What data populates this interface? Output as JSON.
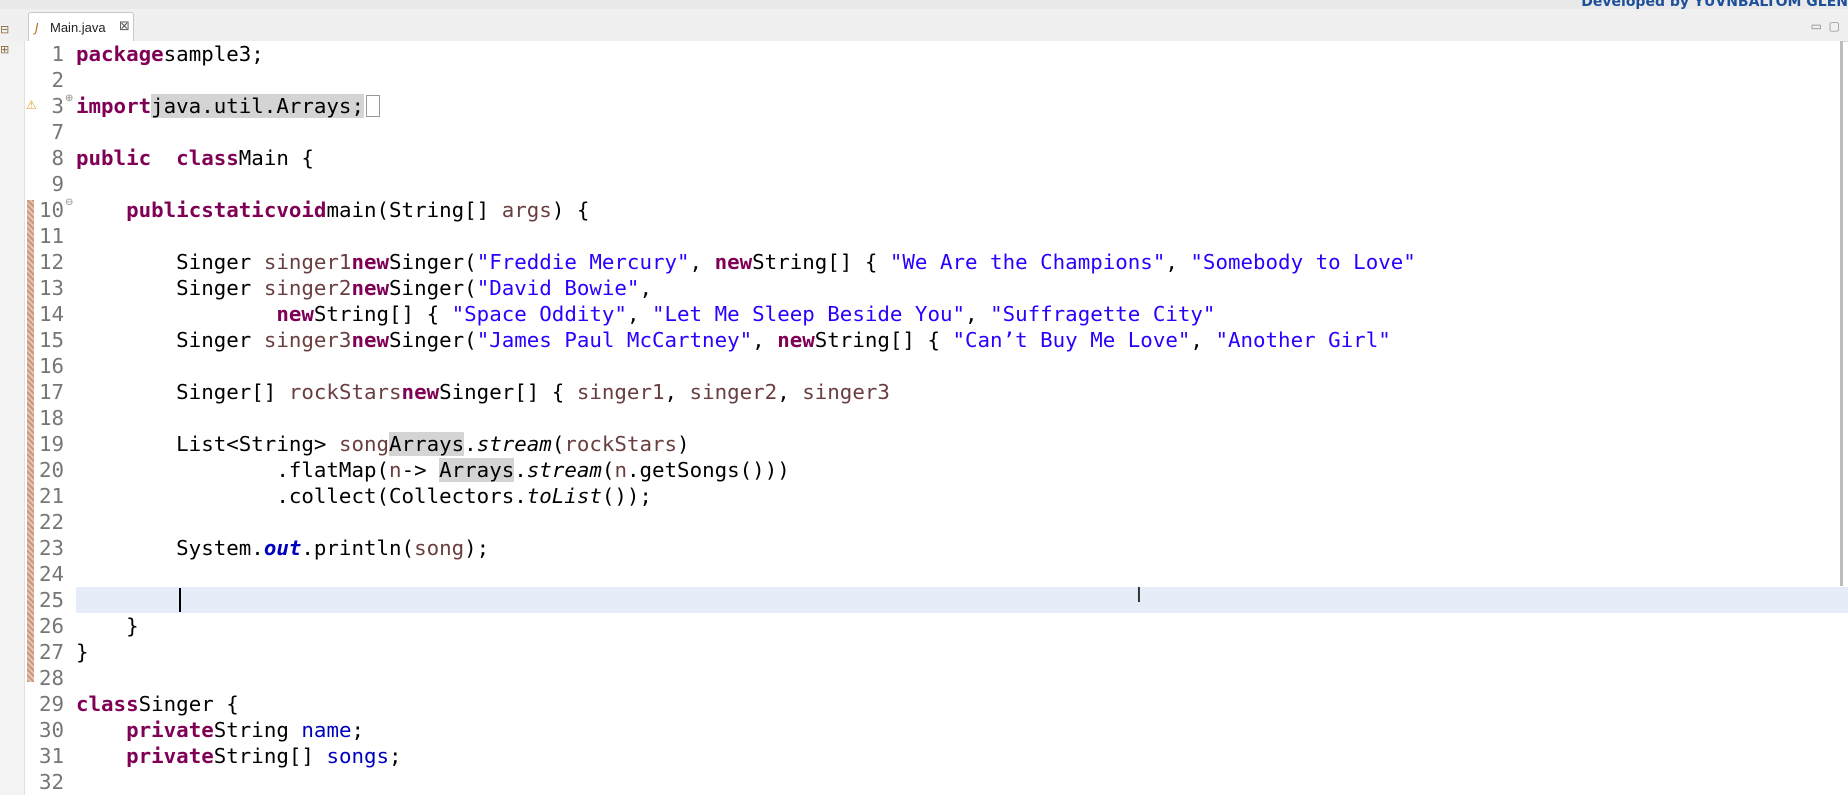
{
  "header": {
    "developer_text": "Developed by YUVNBALTOM GLEN"
  },
  "tab": {
    "label": "Main.java",
    "close": "⊠"
  },
  "window": {
    "minimize": "▭",
    "maximize": "▢"
  },
  "lines": [
    {
      "num": "1",
      "fold": "",
      "tokens": [
        [
          "kw",
          "package"
        ],
        [
          "",
          "sample3;"
        ]
      ]
    },
    {
      "num": "2",
      "fold": "",
      "tokens": []
    },
    {
      "num": "3",
      "fold": "⊕",
      "tokens": [
        [
          "kw",
          "import"
        ],
        [
          "",
          "hl",
          "java.util.Arrays;"
        ]
      ]
    },
    {
      "num": "7",
      "fold": "",
      "tokens": []
    },
    {
      "num": "8",
      "fold": "",
      "tokens": [
        [
          "kw",
          "public"
        ],
        [
          "",
          "  "
        ],
        [
          "kw",
          "class"
        ],
        [
          "",
          "Main {"
        ]
      ]
    },
    {
      "num": "9",
      "fold": "",
      "tokens": []
    },
    {
      "num": "10",
      "fold": "⊖",
      "tokens": [
        [
          "",
          "    "
        ],
        [
          "kw",
          "public"
        ],
        [
          "",
          ""
        ],
        [
          "kw",
          "static"
        ],
        [
          "",
          ""
        ],
        [
          "kw",
          "void"
        ],
        [
          "",
          "main(String[] "
        ],
        [
          "lv",
          "args"
        ],
        [
          "",
          ") {"
        ]
      ]
    },
    {
      "num": "11",
      "fold": "",
      "tokens": []
    },
    {
      "num": "12",
      "fold": "",
      "tokens": [
        [
          "",
          "        Singer "
        ],
        [
          "lv",
          "singer1"
        ],
        [
          "",
          ""
        ],
        [
          "kw",
          "new"
        ],
        [
          "",
          "Singer("
        ],
        [
          "str",
          "\"Freddie Mercury\""
        ],
        [
          "",
          ", "
        ],
        [
          "kw",
          "new"
        ],
        [
          "",
          "String[] { "
        ],
        [
          "str",
          "\"We Are the Champions\""
        ],
        [
          "",
          ", "
        ],
        [
          "str",
          "\"Somebody to Love\""
        ],
        [
          "",
          ""
        ]
      ]
    },
    {
      "num": "13",
      "fold": "",
      "tokens": [
        [
          "",
          "        Singer "
        ],
        [
          "lv",
          "singer2"
        ],
        [
          "",
          ""
        ],
        [
          "kw",
          "new"
        ],
        [
          "",
          "Singer("
        ],
        [
          "str",
          "\"David Bowie\""
        ],
        [
          "",
          ","
        ]
      ]
    },
    {
      "num": "14",
      "fold": "",
      "tokens": [
        [
          "",
          "                "
        ],
        [
          "kw",
          "new"
        ],
        [
          "",
          "String[] { "
        ],
        [
          "str",
          "\"Space Oddity\""
        ],
        [
          "",
          ", "
        ],
        [
          "str",
          "\"Let Me Sleep Beside You\""
        ],
        [
          "",
          ", "
        ],
        [
          "str",
          "\"Suffragette City\""
        ],
        [
          "",
          ""
        ]
      ]
    },
    {
      "num": "15",
      "fold": "",
      "tokens": [
        [
          "",
          "        Singer "
        ],
        [
          "lv",
          "singer3"
        ],
        [
          "",
          ""
        ],
        [
          "kw",
          "new"
        ],
        [
          "",
          "Singer("
        ],
        [
          "str",
          "\"James Paul McCartney\""
        ],
        [
          "",
          ", "
        ],
        [
          "kw",
          "new"
        ],
        [
          "",
          "String[] { "
        ],
        [
          "str",
          "\"Can’t Buy Me Love\""
        ],
        [
          "",
          ", "
        ],
        [
          "str",
          "\"Another Girl\""
        ],
        [
          "",
          ""
        ]
      ]
    },
    {
      "num": "16",
      "fold": "",
      "tokens": []
    },
    {
      "num": "17",
      "fold": "",
      "tokens": [
        [
          "",
          "        Singer[] "
        ],
        [
          "lv",
          "rockStars"
        ],
        [
          "",
          ""
        ],
        [
          "kw",
          "new"
        ],
        [
          "",
          "Singer[] { "
        ],
        [
          "lv",
          "singer1"
        ],
        [
          "",
          ", "
        ],
        [
          "lv",
          "singer2"
        ],
        [
          "",
          ", "
        ],
        [
          "lv",
          "singer3"
        ],
        [
          "",
          ""
        ]
      ]
    },
    {
      "num": "18",
      "fold": "",
      "tokens": []
    },
    {
      "num": "19",
      "fold": "",
      "tokens": [
        [
          "",
          "        List<String> "
        ],
        [
          "lv",
          "song"
        ],
        [
          "",
          ""
        ],
        [
          "hl",
          "Arrays"
        ],
        [
          "",
          "."
        ],
        [
          "it",
          "stream"
        ],
        [
          "",
          "("
        ],
        [
          "lv",
          "rockStars"
        ],
        [
          "",
          ")"
        ]
      ]
    },
    {
      "num": "20",
      "fold": "",
      "tokens": [
        [
          "",
          "                .flatMap("
        ],
        [
          "lv",
          "n"
        ],
        [
          "",
          "-> "
        ],
        [
          "hl",
          "Arrays"
        ],
        [
          "",
          "."
        ],
        [
          "it",
          "stream"
        ],
        [
          "",
          "("
        ],
        [
          "lv",
          "n"
        ],
        [
          "",
          ".getSongs()))"
        ]
      ]
    },
    {
      "num": "21",
      "fold": "",
      "tokens": [
        [
          "",
          "                .collect(Collectors."
        ],
        [
          "it",
          "toList"
        ],
        [
          "",
          "());"
        ]
      ]
    },
    {
      "num": "22",
      "fold": "",
      "tokens": []
    },
    {
      "num": "23",
      "fold": "",
      "tokens": [
        [
          "",
          "        System."
        ],
        [
          "sf",
          "out"
        ],
        [
          "",
          ".println("
        ],
        [
          "lv",
          "song"
        ],
        [
          "",
          ");"
        ]
      ]
    },
    {
      "num": "24",
      "fold": "",
      "tokens": []
    },
    {
      "num": "25",
      "fold": "",
      "tokens": []
    },
    {
      "num": "26",
      "fold": "",
      "tokens": [
        [
          "",
          "    }"
        ]
      ]
    },
    {
      "num": "27",
      "fold": "",
      "tokens": [
        [
          "",
          "}"
        ]
      ]
    },
    {
      "num": "28",
      "fold": "",
      "tokens": []
    },
    {
      "num": "29",
      "fold": "",
      "tokens": [
        [
          "kw",
          "class"
        ],
        [
          "",
          "Singer {"
        ]
      ]
    },
    {
      "num": "30",
      "fold": "",
      "tokens": [
        [
          "",
          "    "
        ],
        [
          "kw",
          "private"
        ],
        [
          "",
          "String "
        ],
        [
          "fld",
          "name"
        ],
        [
          "",
          ";"
        ]
      ]
    },
    {
      "num": "31",
      "fold": "",
      "tokens": [
        [
          "",
          "    "
        ],
        [
          "kw",
          "private"
        ],
        [
          "",
          "String[] "
        ],
        [
          "fld",
          "songs"
        ],
        [
          "",
          ";"
        ]
      ]
    },
    {
      "num": "32",
      "fold": "",
      "tokens": []
    }
  ]
}
